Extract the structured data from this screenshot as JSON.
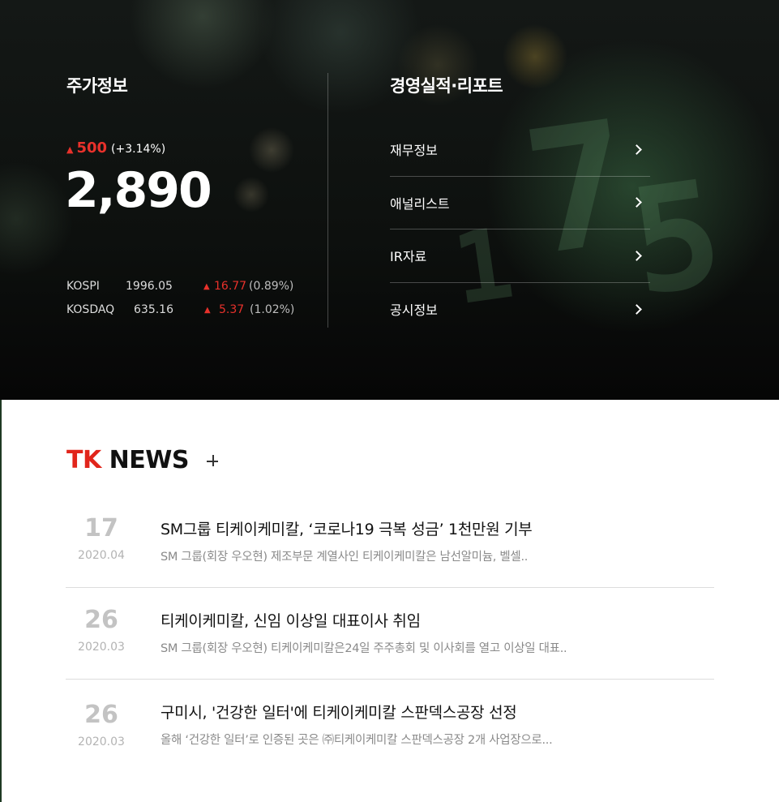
{
  "stock": {
    "title": "주가정보",
    "arrow": "▲",
    "change": "500",
    "change_pct": "(+3.14%)",
    "price": "2,890",
    "indices": [
      {
        "name": "KOSPI",
        "value": "1996.05",
        "arrow": "▲",
        "change": "16.77",
        "pct": "(0.89%)"
      },
      {
        "name": "KOSDAQ",
        "value": "635.16",
        "arrow": "▲",
        "change": "5.37",
        "pct": "(1.02%)"
      }
    ]
  },
  "reports": {
    "title": "경영실적·리포트",
    "items": [
      {
        "label": "재무정보"
      },
      {
        "label": "애널리스트"
      },
      {
        "label": "IR자료"
      },
      {
        "label": "공시정보"
      }
    ]
  },
  "news": {
    "title_accent": "TK",
    "title_rest": " NEWS",
    "more_icon": "plus-icon",
    "items": [
      {
        "day": "17",
        "year_month": "2020.04",
        "headline": "SM그룹 티케이케미칼, ‘코로나19 극복 성금’ 1천만원 기부",
        "summary": "SM 그룹(회장 우오현) 제조부문  계열사인 티케이케미칼은 남선알미늄,  벨셀.."
      },
      {
        "day": "26",
        "year_month": "2020.03",
        "headline": "티케이케미칼,  신임 이상일 대표이사 취임",
        "summary": "SM 그룹(회장 우오현) 티케이케미칼은24일 주주총회 및 이사회를 열고  이상일 대표.."
      },
      {
        "day": "26",
        "year_month": "2020.03",
        "headline": "구미시, '건강한 일터'에 티케이케미칼 스판덱스공장 선정",
        "summary": "올해 ‘건강한 일터’로 인증된 곳은 ㈜티케이케미칼 스판덱스공장 2개 사업장으로..."
      }
    ]
  },
  "colors": {
    "accent_red": "#e1251b",
    "hero_bg": "#0c0e0d"
  }
}
